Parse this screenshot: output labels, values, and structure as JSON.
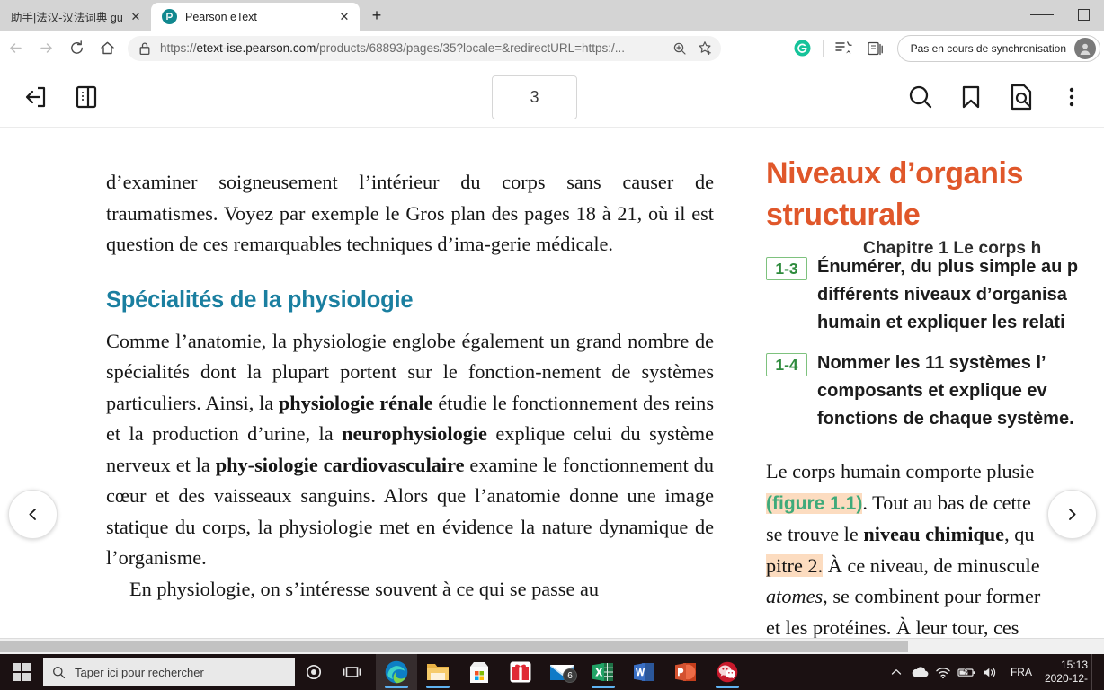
{
  "browser": {
    "tabs": [
      {
        "title": "助手|法汉-汉法词典 gui是什",
        "favicon": "globe-icon",
        "active": false
      },
      {
        "title": "Pearson eText",
        "favicon": "pearson-icon",
        "active": true
      }
    ],
    "new_tab_label": "+",
    "close_label": "✕",
    "window_controls": {
      "minimize": "–",
      "maximize": "□"
    },
    "url_prefix": "https://",
    "url_domain": "etext-ise.pearson.com",
    "url_path": "/products/68893/pages/35?locale=&redirectURL=https:/...",
    "lock_icon": "lock-icon",
    "zoom_icon": "zoom-icon",
    "favorite_icon": "star-add-icon",
    "extension_icon": "grammarly-icon",
    "collections_icon": "collections-icon",
    "favorites_bar_icon": "favorites-list-icon",
    "sync_label": "Pas en cours de synchronisation",
    "profile_icon": "avatar-icon",
    "back_icon": "back-arrow-icon",
    "forward_icon": "forward-arrow-icon",
    "reload_icon": "reload-icon",
    "home_icon": "home-icon"
  },
  "etext_toolbar": {
    "exit_icon": "exit-reader-icon",
    "panel_icon": "toggle-sidebar-icon",
    "page_number": "3",
    "search_icon": "search-icon",
    "bookmark_icon": "bookmark-icon",
    "page_search_icon": "page-search-icon",
    "more_icon": "more-vertical-icon"
  },
  "reader": {
    "prev_arrow": "‹",
    "next_arrow": "›",
    "chapter_header": "Chapitre 1  Le corps h",
    "left_column": {
      "paragraph_1": "d’examiner soigneusement l’intérieur du corps sans causer de traumatismes. Voyez par exemple le Gros plan des pages 18 à 21, où il est question de ces remarquables techniques d’ima-gerie médicale.",
      "heading": "Spécialités de la physiologie",
      "paragraph_2_a": "Comme l’anatomie, la physiologie englobe également un grand nombre de spécialités dont la plupart portent sur le fonction-nement de systèmes particuliers. Ainsi, la ",
      "paragraph_2_bold1": "physiologie rénale",
      "paragraph_2_b": " étudie le fonctionnement des reins et la production d’urine, la ",
      "paragraph_2_bold2": "neurophysiologie",
      "paragraph_2_c": " explique celui du système nerveux et la ",
      "paragraph_2_bold3": "phy-siologie cardiovasculaire",
      "paragraph_2_d": " examine le fonctionnement du cœur et des vaisseaux sanguins. Alors que l’anatomie donne une image statique du corps, la physiologie met en évidence la nature dynamique de l’organisme.",
      "paragraph_3": "En physiologie, on s’intéresse souvent à ce qui se passe au"
    },
    "right_column": {
      "heading_line1": "Niveaux d’organis",
      "heading_line2": "structurale",
      "objectives": [
        {
          "badge": "1-3",
          "lines": [
            "Énumérer, du plus simple au p",
            "différents niveaux d’organisa",
            "humain et expliquer les relati"
          ]
        },
        {
          "badge": "1-4",
          "lines": [
            "Nommer les 11 systèmes  l’",
            "composants et explique    ev",
            "fonctions de chaque système."
          ]
        }
      ],
      "body_lines": [
        {
          "text": "Le corps humain comporte plusie"
        },
        {
          "figure_ref": "(figure 1.1)",
          "text": ". Tout au bas de cette"
        },
        {
          "pre": "se trouve le ",
          "bold": "niveau chimique",
          "post": ", qu"
        },
        {
          "highlight": "pitre 2.",
          "text": " À ce niveau, de minuscule"
        },
        {
          "italic": "atomes",
          "text": ", se combinent pour former"
        },
        {
          "text": "et les protéines. À leur tour, ces"
        }
      ]
    }
  },
  "taskbar": {
    "start_icon": "windows-start-icon",
    "search_placeholder": "Taper ici pour rechercher",
    "search_icon": "search-icon",
    "cortana_icon": "cortana-circle-icon",
    "taskview_icon": "task-view-icon",
    "apps": [
      {
        "name": "edge-icon",
        "label": "Microsoft Edge",
        "active": true,
        "running": true
      },
      {
        "name": "file-explorer-icon",
        "label": "Explorateur de fichiers",
        "running": true
      },
      {
        "name": "microsoft-store-icon",
        "label": "Microsoft Store",
        "running": false
      },
      {
        "name": "gift-icon",
        "label": "Cadeau",
        "running": false
      },
      {
        "name": "mail-icon",
        "label": "Courrier",
        "badge": "6",
        "running": false
      },
      {
        "name": "excel-icon",
        "label": "Excel",
        "running": true
      },
      {
        "name": "word-icon",
        "label": "Word",
        "running": false
      },
      {
        "name": "powerpoint-icon",
        "label": "PowerPoint",
        "running": false
      },
      {
        "name": "wechat-icon",
        "label": "WeChat",
        "running": true
      }
    ],
    "tray": {
      "chevron": "^",
      "onedrive_icon": "onedrive-cloud-icon",
      "wifi_icon": "wifi-icon",
      "battery_icon": "battery-charging-icon",
      "volume_icon": "volume-icon",
      "language": "FRA",
      "time": "15:13",
      "date": "2020-12-"
    }
  },
  "colors": {
    "heading_teal": "#1a7fa0",
    "heading_orange": "#e0572a",
    "badge_green": "#2e8b3d",
    "badge_border": "#7ec27e",
    "figure_green": "#3faa7a",
    "highlight_peach": "#fcdcc0",
    "taskbar_bg": "#1b1112",
    "tabbar_bg": "#d4d4d4"
  }
}
